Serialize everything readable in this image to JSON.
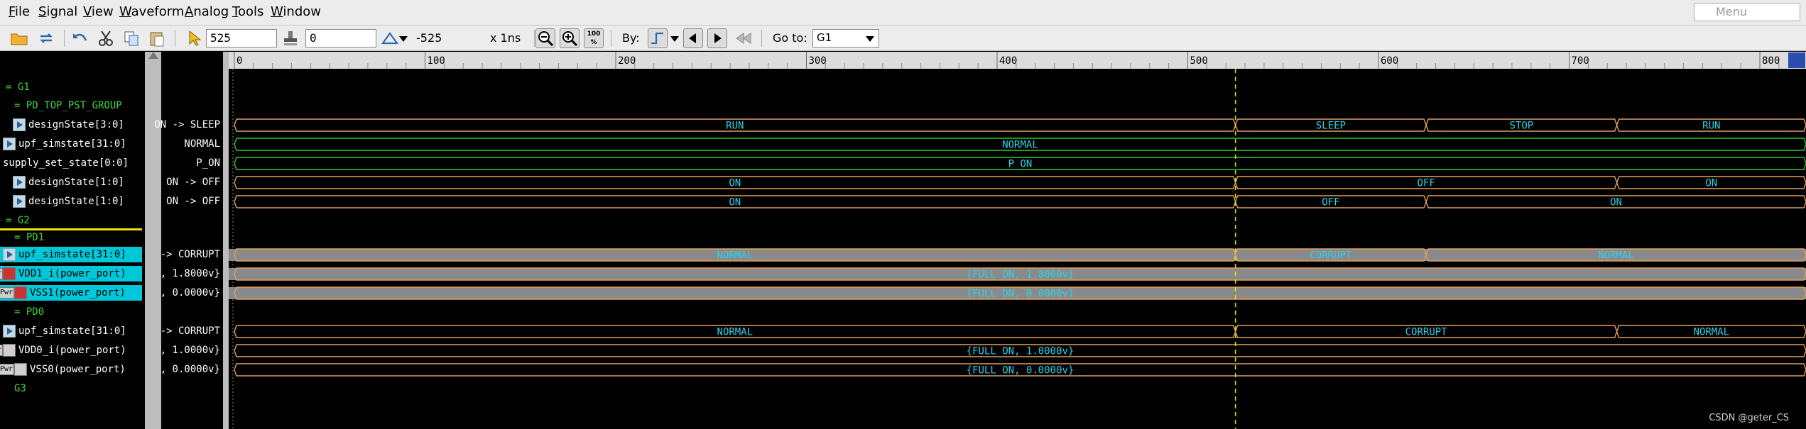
{
  "menubar": {
    "items": [
      "File",
      "Signal",
      "View",
      "Waveform",
      "Analog",
      "Tools",
      "Window"
    ],
    "mnemonics": [
      "F",
      "S",
      "V",
      "W",
      "A",
      "T",
      "W"
    ],
    "search_placeholder": "Menu"
  },
  "toolbar": {
    "cursor_time": "525",
    "marker_time": "0",
    "delta": "-525",
    "time_unit": "x 1ns",
    "zoom_fit_label": "100 %",
    "by_label": "By:",
    "goto_label": "Go to:",
    "goto_value": "G1"
  },
  "ruler": {
    "ticks": [
      "0",
      "100",
      "200",
      "300",
      "400",
      "500",
      "600",
      "700",
      "800"
    ]
  },
  "signals": [
    {
      "id": "g1",
      "kind": "group",
      "name": "= G1",
      "value": ""
    },
    {
      "id": "pd_top",
      "kind": "group",
      "name": "= PD_TOP_PST_GROUP",
      "value": ""
    },
    {
      "id": "ds30",
      "kind": "signal",
      "name": "designState[3:0]",
      "value": "ON -> SLEEP",
      "segments": [
        {
          "t0": 0,
          "t1": 525,
          "label": "RUN"
        },
        {
          "t0": 525,
          "t1": 625,
          "label": "SLEEP"
        },
        {
          "t0": 625,
          "t1": 725,
          "label": "STOP"
        },
        {
          "t0": 725,
          "t1": 825,
          "label": "RUN"
        }
      ]
    },
    {
      "id": "upf1",
      "kind": "signal",
      "name": "upf_simstate[31:0]",
      "value": "NORMAL",
      "segments": [
        {
          "t0": 0,
          "t1": 825,
          "label": "NORMAL"
        }
      ]
    },
    {
      "id": "sss",
      "kind": "signal",
      "name": "supply_set_state[0:0]",
      "value": "P_ON",
      "segments": [
        {
          "t0": 0,
          "t1": 825,
          "label": "P_ON"
        }
      ]
    },
    {
      "id": "ds10a",
      "kind": "signal",
      "name": "designState[1:0]",
      "value": "ON -> OFF",
      "segments": [
        {
          "t0": 0,
          "t1": 525,
          "label": "ON"
        },
        {
          "t0": 525,
          "t1": 725,
          "label": "OFF"
        },
        {
          "t0": 725,
          "t1": 825,
          "label": "ON"
        }
      ]
    },
    {
      "id": "ds10b",
      "kind": "signal",
      "name": "designState[1:0]",
      "value": "ON -> OFF",
      "segments": [
        {
          "t0": 0,
          "t1": 525,
          "label": "ON"
        },
        {
          "t0": 525,
          "t1": 625,
          "label": "OFF"
        },
        {
          "t0": 625,
          "t1": 825,
          "label": "ON"
        }
      ]
    },
    {
      "id": "g2",
      "kind": "group",
      "name": "= G2",
      "value": ""
    },
    {
      "id": "pd1",
      "kind": "group",
      "name": "= PD1",
      "value": ""
    },
    {
      "id": "upf_pd1",
      "kind": "signal",
      "name": "upf_simstate[31:0]",
      "value": "-> CORRUPT",
      "selected": true,
      "segments": [
        {
          "t0": 0,
          "t1": 525,
          "label": "NORMAL"
        },
        {
          "t0": 525,
          "t1": 625,
          "label": "CORRUPT"
        },
        {
          "t0": 625,
          "t1": 825,
          "label": "NORMAL"
        }
      ]
    },
    {
      "id": "vdd1",
      "kind": "power",
      "name": "VDD1_i(power_port)",
      "value": ", 1.8000v}",
      "selected": true,
      "segments": [
        {
          "t0": 0,
          "t1": 825,
          "label": "{FULL_ON, 1.8000v}"
        }
      ]
    },
    {
      "id": "vss1",
      "kind": "power",
      "name": "VSS1(power_port)",
      "value": ", 0.0000v}",
      "selected": true,
      "segments": [
        {
          "t0": 0,
          "t1": 825,
          "label": "{FULL_ON, 0.0000v}"
        }
      ]
    },
    {
      "id": "pd0",
      "kind": "group",
      "name": "= PD0",
      "value": ""
    },
    {
      "id": "upf_pd0",
      "kind": "signal",
      "name": "upf_simstate[31:0]",
      "value": "-> CORRUPT",
      "segments": [
        {
          "t0": 0,
          "t1": 525,
          "label": "NORMAL"
        },
        {
          "t0": 525,
          "t1": 725,
          "label": "CORRUPT"
        },
        {
          "t0": 725,
          "t1": 825,
          "label": "NORMAL"
        }
      ]
    },
    {
      "id": "vdd0",
      "kind": "power",
      "name": "VDD0_i(power_port)",
      "value": ", 1.0000v}",
      "segments": [
        {
          "t0": 0,
          "t1": 825,
          "label": "{FULL_ON, 1.0000v}"
        }
      ]
    },
    {
      "id": "vss0",
      "kind": "power",
      "name": "VSS0(power_port)",
      "value": ", 0.0000v}",
      "segments": [
        {
          "t0": 0,
          "t1": 825,
          "label": "{FULL_ON, 0.0000v}"
        }
      ]
    },
    {
      "id": "g3",
      "kind": "group",
      "name": "G3",
      "value": ""
    }
  ],
  "cursor_time_ns": 525,
  "colors": {
    "group_text": "#3ed33e",
    "wave_text": "#2fd0e6",
    "wave_line": "#e0a060",
    "selected_band": "#00c8d8",
    "cursor_line": "#e6e600"
  },
  "watermark": "CSDN @geter_CS"
}
